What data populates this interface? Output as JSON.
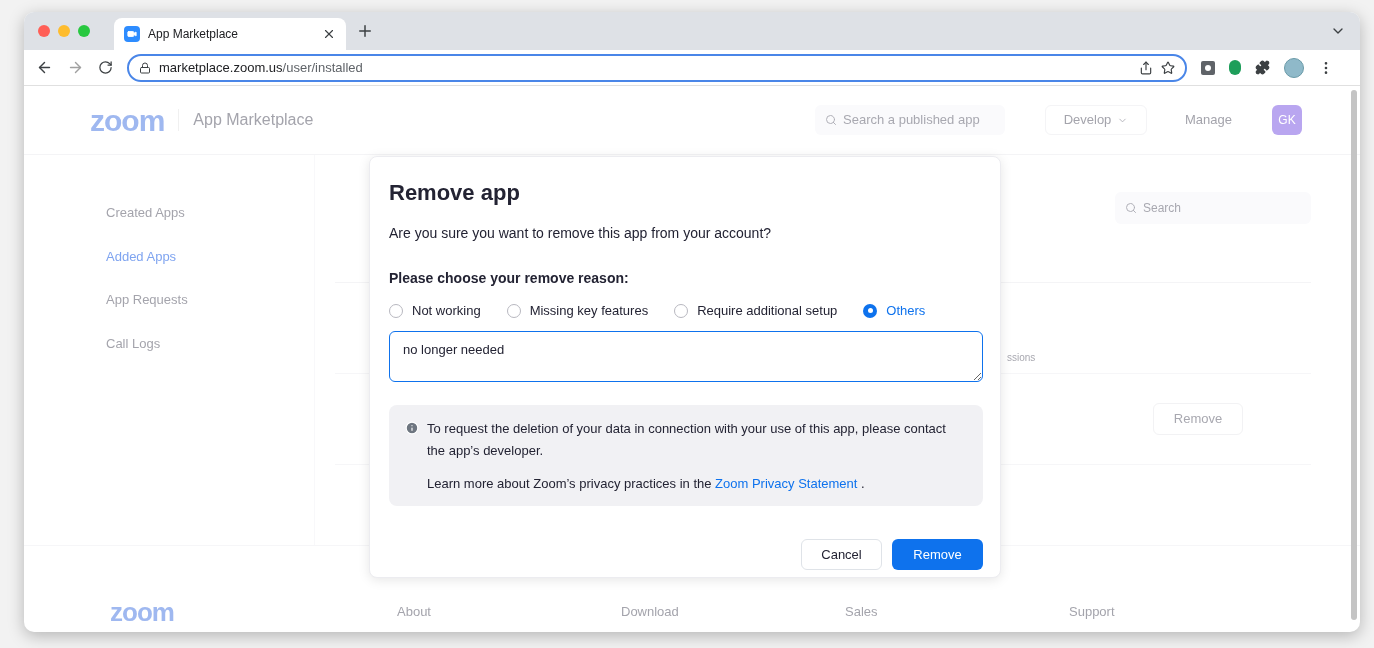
{
  "browser": {
    "tab": {
      "title": "App Marketplace"
    },
    "url": {
      "host": "marketplace.zoom.us",
      "path": "/user/installed"
    }
  },
  "header": {
    "logo": "zoom",
    "brand": "App Marketplace",
    "search_placeholder": "Search a published app",
    "develop": "Develop",
    "manage": "Manage",
    "avatar": "GK"
  },
  "sidebar": {
    "items": [
      {
        "label": "Created Apps",
        "selected": false
      },
      {
        "label": "Added Apps",
        "selected": true
      },
      {
        "label": "App Requests",
        "selected": false
      },
      {
        "label": "Call Logs",
        "selected": false
      }
    ]
  },
  "content": {
    "search_placeholder": "Search",
    "partial_text": "ssions",
    "remove_button": "Remove"
  },
  "footer": {
    "logo": "zoom",
    "links": [
      "About",
      "Download",
      "Sales",
      "Support"
    ]
  },
  "dialog": {
    "title": "Remove app",
    "message": "Are you sure you want to remove this app from your account?",
    "reason_label": "Please choose your remove reason:",
    "reasons": [
      {
        "label": "Not working",
        "selected": false
      },
      {
        "label": "Missing key features",
        "selected": false
      },
      {
        "label": "Require additional setup",
        "selected": false
      },
      {
        "label": "Others",
        "selected": true
      }
    ],
    "reason_text": "no longer needed",
    "notice": {
      "text": "To request the deletion of your data in connection with your use of this app, please contact the app’s developer.",
      "privacy_prefix": "Learn more about Zoom’s privacy practices in the",
      "privacy_link": "Zoom Privacy Statement",
      "privacy_suffix": "."
    },
    "buttons": [
      {
        "label": "Cancel",
        "kind": "secondary"
      },
      {
        "label": "Remove",
        "kind": "primary"
      }
    ]
  }
}
